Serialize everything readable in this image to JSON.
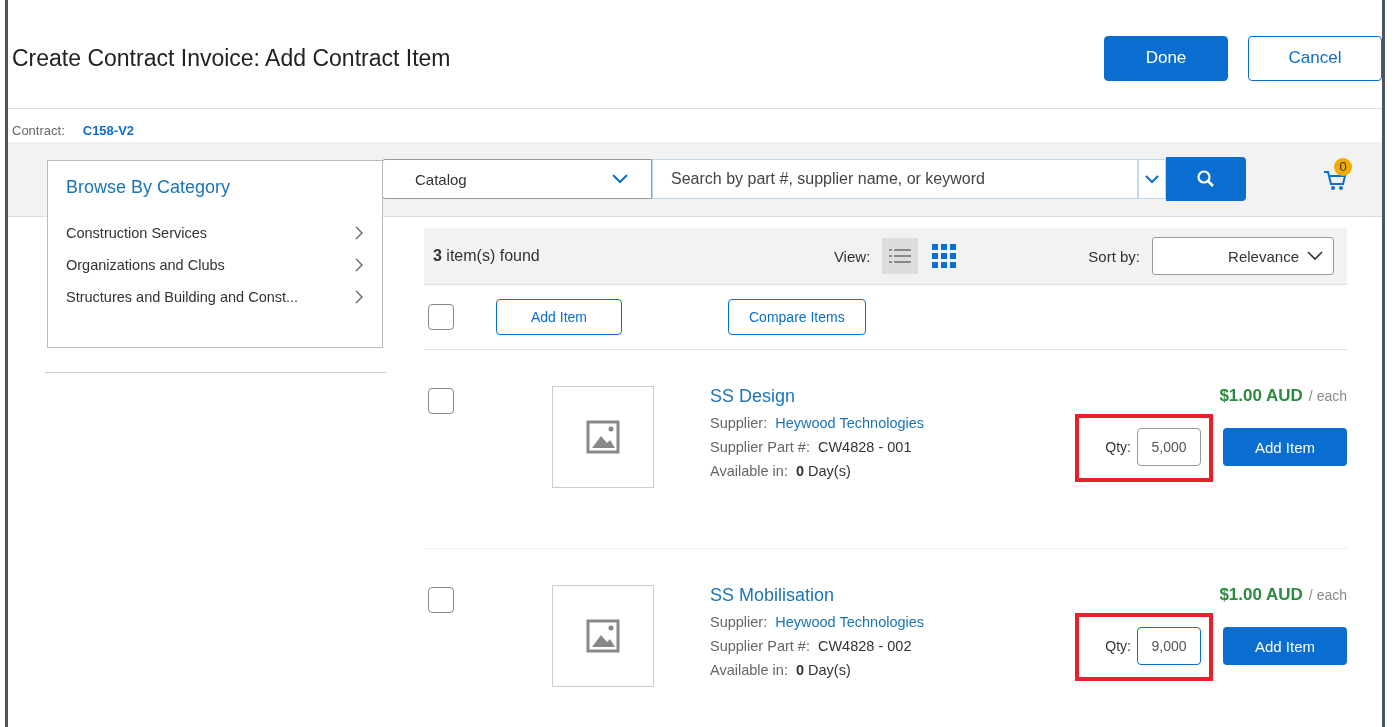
{
  "window": {
    "title": "Create Contract Invoice: Add Contract Item"
  },
  "header_buttons": [
    {
      "label": "Done",
      "kind": "primary"
    },
    {
      "label": "Cancel",
      "kind": "secondary"
    }
  ],
  "contract": {
    "label": "Contract:",
    "value": "C158-V2"
  },
  "search": {
    "scope": "Catalog",
    "placeholder": "Search by part #, supplier name, or keyword"
  },
  "cart": {
    "count": "0"
  },
  "category_menu": {
    "title": "Browse By Category",
    "items": [
      {
        "label": "Construction Services"
      },
      {
        "label": "Organizations and Clubs"
      },
      {
        "label": "Structures and Building and Const..."
      }
    ]
  },
  "results": {
    "count": "3",
    "count_label": "item(s) found",
    "view_label": "View:",
    "views": [
      {
        "kind": "list",
        "selected": true
      },
      {
        "kind": "grid",
        "selected": false
      }
    ],
    "sort_label": "Sort by:",
    "sort_value": "Relevance",
    "select_all_checked": false,
    "actions": [
      "Add Item",
      "Compare Items"
    ]
  },
  "items": [
    {
      "name": "SS Design",
      "supplier_label": "Supplier:",
      "supplier": "Heywood Technologies",
      "part_label": "Supplier Part #:",
      "part": "CW4828 - 001",
      "avail_label": "Available in:",
      "avail_days": "0",
      "avail_unit": "Day(s)",
      "price": "$1.00 AUD",
      "price_unit": "/ each",
      "qty_label": "Qty:",
      "qty": "5,000",
      "checked": false,
      "highlighted": true,
      "focused": false,
      "button": "Add Item"
    },
    {
      "name": "SS Mobilisation",
      "supplier_label": "Supplier:",
      "supplier": "Heywood Technologies",
      "part_label": "Supplier Part #:",
      "part": "CW4828 - 002",
      "avail_label": "Available in:",
      "avail_days": "0",
      "avail_unit": "Day(s)",
      "price": "$1.00 AUD",
      "price_unit": "/ each",
      "qty_label": "Qty:",
      "qty": "9,000",
      "checked": false,
      "highlighted": true,
      "focused": true,
      "button": "Add Item"
    }
  ]
}
